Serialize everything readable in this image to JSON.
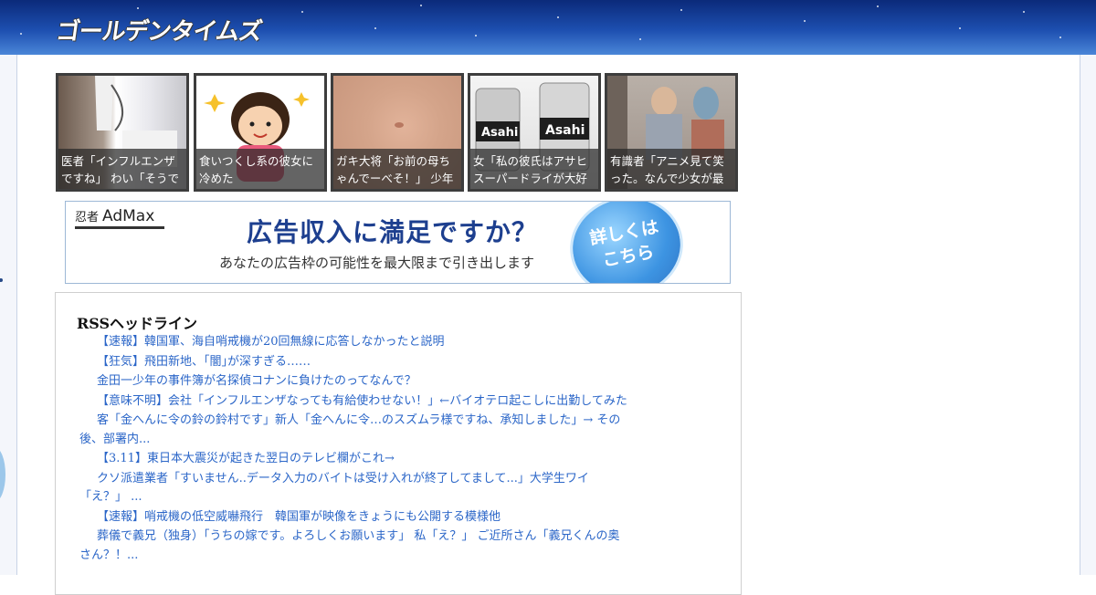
{
  "site": {
    "logo": "ゴールデンタイムズ"
  },
  "thumbnails": [
    {
      "caption": "医者「インフルエンザですね」 わい「そうで",
      "image_icon": "doctor-photo"
    },
    {
      "caption": "食いつくし系の彼女に冷めた",
      "image_icon": "girl-eating-illustration"
    },
    {
      "caption": "ガキ大将「お前の母ちゃんでーべそ！」 少年",
      "image_icon": "belly-photo"
    },
    {
      "caption": "女「私の彼氏はアサヒスーパードライが大好",
      "image_icon": "beer-cans-photo"
    },
    {
      "caption": "有識者「アニメ見て笑った。なんで少女が最",
      "image_icon": "anime-scene"
    }
  ],
  "ad": {
    "brand_ja": "忍者",
    "brand": "AdMax",
    "headline": "広告収入に満足ですか？",
    "subline": "あなたの広告枠の可能性を最大限まで引き出します",
    "button_line1": "詳しくは",
    "button_line2": "こちら"
  },
  "rss": {
    "title": "RSSヘッドライン",
    "items": [
      "【速報】韓国軍、海自哨戒機が20回無線に応答しなかったと説明",
      "【狂気】飛田新地、｢闇｣が深すぎる‥‥‥",
      "金田一少年の事件簿が名探偵コナンに負けたのってなんで？",
      "【意味不明】会社「インフルエンザなっても有給使わせない！」←バイオテロ起こしに出勤してみた",
      "客「金へんに令の鈴の鈴村です」新人「金へんに令…のスズムラ様ですね、承知しました」→ その後、部署内...",
      "【3.11】東日本大震災が起きた翌日のテレビ欄がこれ→",
      "クソ派遣業者「すいません..データ入力のバイトは受け入れが終了してまして...」大学生ワイ「え？」 ...",
      "【速報】哨戒機の低空威嚇飛行　韓国軍が映像をきょうにも公開する模様他",
      "葬儀で義兄（独身）「うちの嫁です。よろしくお願います」 私「え？」 ご近所さん「義兄くんの奥さん？！..."
    ]
  },
  "colors": {
    "header_top": "#0b2a7a",
    "header_bottom": "#4a86d8",
    "link": "#2b66c8",
    "caption_bg": "rgba(40,40,40,0.72)"
  }
}
